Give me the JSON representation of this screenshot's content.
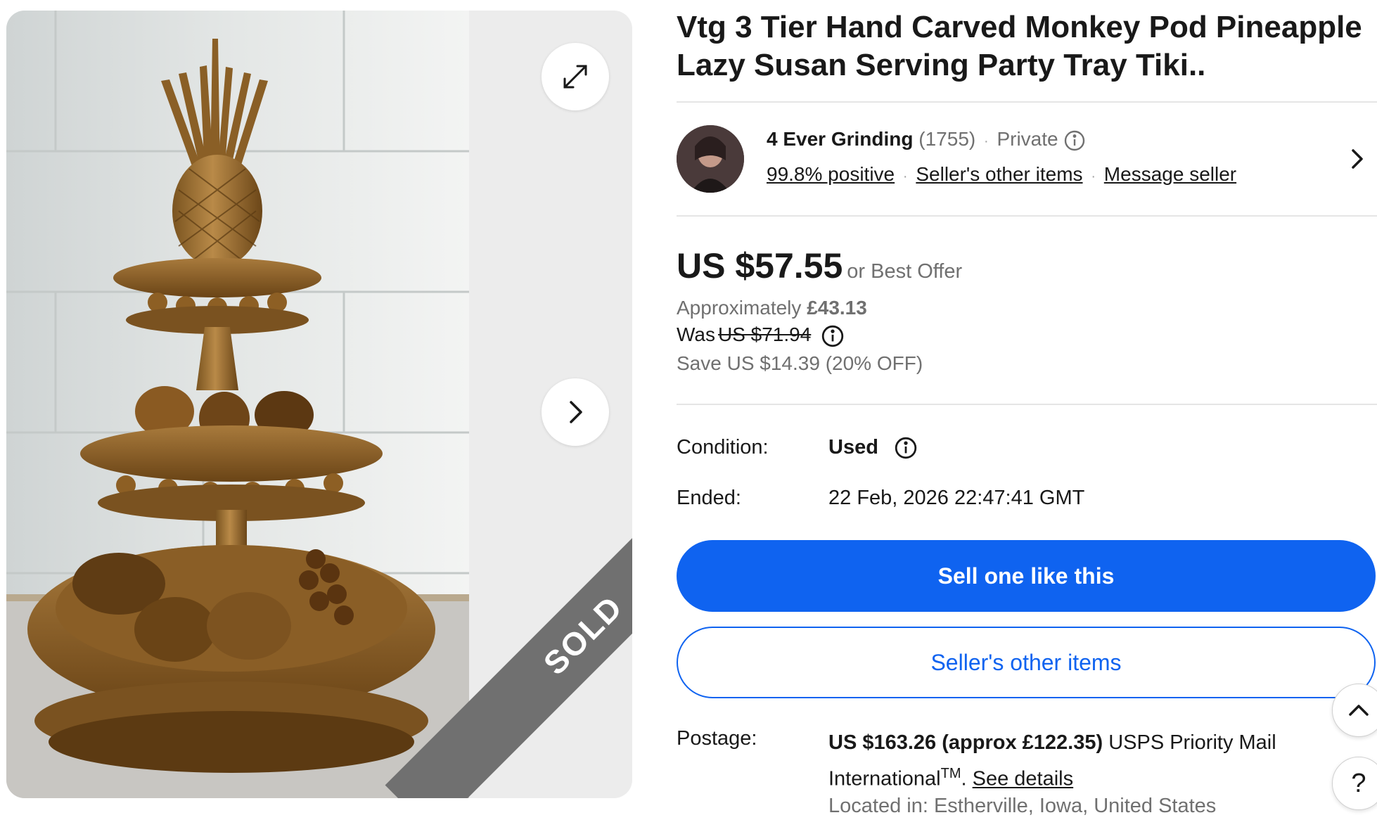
{
  "listing": {
    "title": "Vtg 3 Tier Hand Carved Monkey Pod Pineapple Lazy Susan Serving Party Tray Tiki..",
    "sold_label": "SOLD"
  },
  "gallery": {
    "expand_icon": "expand-arrows-icon",
    "next_icon": "chevron-right-icon"
  },
  "seller": {
    "name": "4 Ever Grinding",
    "feedback_count": "(1755)",
    "type": "Private",
    "positive": "99.8% positive",
    "other_items_link": "Seller's other items",
    "message_link": "Message seller"
  },
  "price": {
    "current": "US $57.55",
    "offer": "or Best Offer",
    "approx_label": "Approximately",
    "approx_value": "£43.13",
    "was_label": "Was",
    "was_value": "US $71.94",
    "save": "Save US $14.39 (20% OFF)"
  },
  "details": {
    "condition_label": "Condition:",
    "condition_value": "Used",
    "ended_label": "Ended:",
    "ended_value": "22 Feb, 2026 22:47:41 GMT"
  },
  "actions": {
    "sell_like_this": "Sell one like this",
    "sellers_other_items": "Seller's other items"
  },
  "postage": {
    "label": "Postage:",
    "price": "US $163.26 (approx £122.35)",
    "service": "USPS Priority Mail International",
    "trademark": "TM",
    "see_details": "See details",
    "located": "Located in: Estherville, Iowa, United States"
  },
  "floating": {
    "help_label": "?"
  },
  "colors": {
    "primary_blue": "#0f63f0",
    "text": "#191919",
    "muted": "#707070",
    "sold_ribbon": "#707070"
  }
}
